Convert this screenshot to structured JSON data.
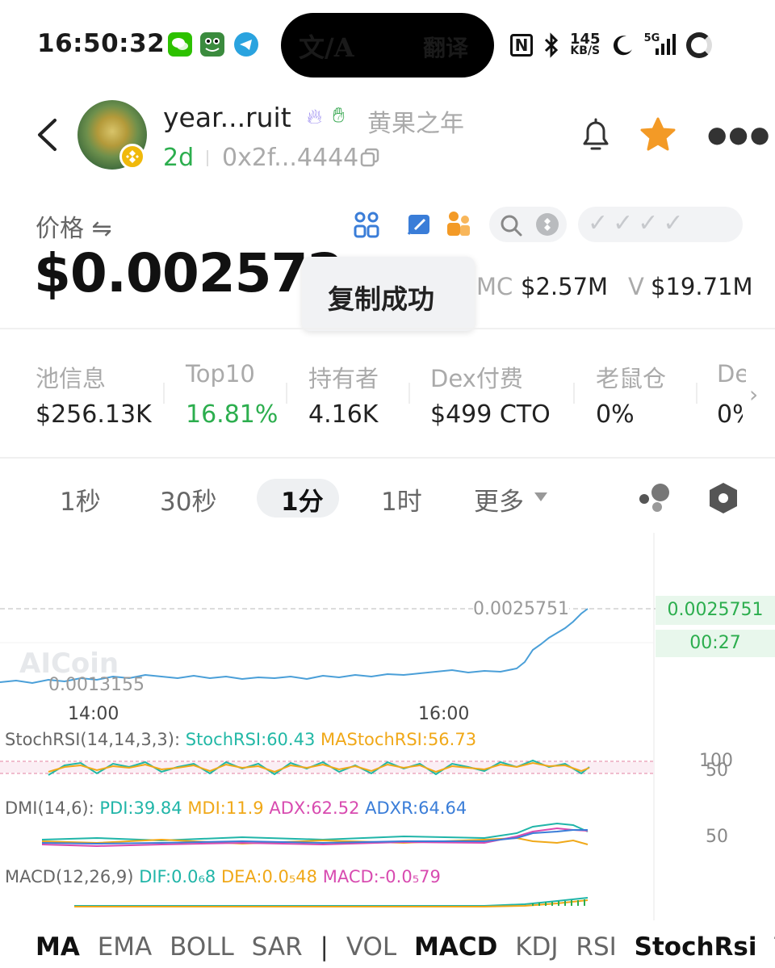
{
  "status_bar": {
    "time": "16:50:32",
    "translate_label": "翻译",
    "translate_glyph": "文/A",
    "nfc": "N",
    "speed_value": "145",
    "speed_unit": "KB/S",
    "network": "5G",
    "icons": [
      "wechat-icon",
      "frog-app-icon",
      "telegram-icon",
      "bluetooth-icon",
      "moon-icon",
      "signal-icon",
      "battery-ring-icon"
    ]
  },
  "token": {
    "name": "year...ruit",
    "cn_name": "黄果之年",
    "age": "2d",
    "address": "0x2f...4444"
  },
  "price": {
    "label": "价格 ⇋",
    "value": "$0.002572",
    "mc_label": "MC",
    "mc_value": "$2.57M",
    "v_label": "V",
    "v_value": "$19.71M"
  },
  "toast": "复制成功",
  "checks": "✓✓✓✓",
  "stats": [
    {
      "label": "池信息",
      "value": "$256.13K",
      "color": "#222"
    },
    {
      "label": "Top10",
      "value": "16.81%",
      "color": "#2cae4e"
    },
    {
      "label": "持有者",
      "value": "4.16K",
      "color": "#222"
    },
    {
      "label": "Dex付费",
      "value": "$499 CTO",
      "color": "#222"
    },
    {
      "label": "老鼠仓",
      "value": "0%",
      "color": "#222"
    },
    {
      "label": "De",
      "value": "0%",
      "color": "#222"
    }
  ],
  "intervals": [
    "1秒",
    "30秒",
    "1分",
    "1时",
    "更多"
  ],
  "selected_interval": "1分",
  "chart": {
    "watermark": "AICoin",
    "high_label": "0.0025751",
    "low_label": "0.0013155",
    "current_price": "0.0025751",
    "countdown": "00:27",
    "x_labels": [
      "14:00",
      "16:00"
    ],
    "stochrsi": {
      "params": "StochRSI(14,14,3,3):",
      "a": "StochRSI:60.43",
      "b": "MAStochRSI:56.73",
      "scale_hi": "100",
      "scale_lo": "50"
    },
    "dmi": {
      "params": "DMI(14,6):",
      "pdi": "PDI:39.84",
      "mdi": "MDI:11.9",
      "adx": "ADX:62.52",
      "adxr": "ADXR:64.64",
      "scale": "50"
    },
    "macd": {
      "params": "MACD(12,26,9)",
      "dif": "DIF:0.0₆8",
      "dea": "DEA:0.0₅48",
      "macd": "MACD:-0.0₅79"
    },
    "colors": {
      "price_line": "#4a9fd8",
      "green": "#2cae4e",
      "stoch": "#22b8a6",
      "ma": "#f0a818",
      "pdi": "#20b5a8",
      "mdi": "#f0a818",
      "adx": "#d84bb0",
      "adxr": "#3a7dd8"
    }
  },
  "indicators": [
    "MA",
    "EMA",
    "BOLL",
    "SAR",
    "|",
    "VOL",
    "MACD",
    "KDJ",
    "RSI",
    "StochRsi",
    "TR"
  ],
  "selected_indicators": [
    "MA",
    "MACD",
    "StochRsi"
  ]
}
